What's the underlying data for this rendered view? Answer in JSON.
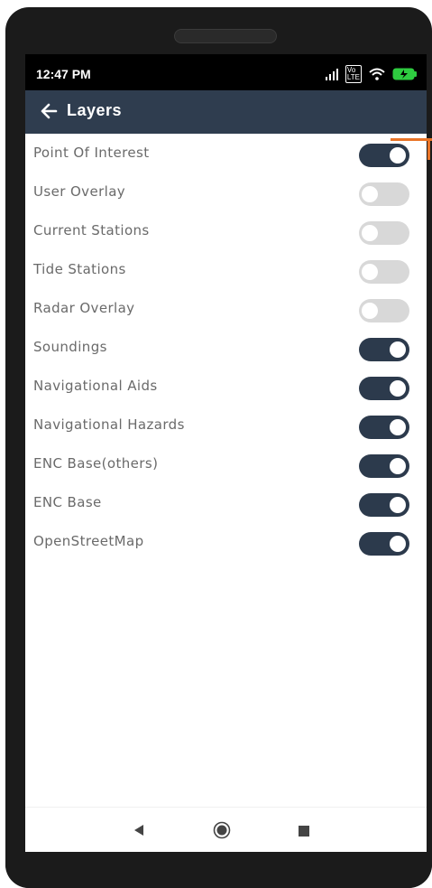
{
  "status_bar": {
    "time": "12:47 PM",
    "volte_label": "Vo) LTE"
  },
  "app_bar": {
    "title": "Layers",
    "back_icon": "arrow-left-icon"
  },
  "layers": [
    {
      "label": "Point Of Interest",
      "enabled": true
    },
    {
      "label": "User Overlay",
      "enabled": false
    },
    {
      "label": "Current Stations",
      "enabled": false
    },
    {
      "label": "Tide Stations",
      "enabled": false
    },
    {
      "label": "Radar Overlay",
      "enabled": false
    },
    {
      "label": "Soundings",
      "enabled": true
    },
    {
      "label": "Navigational Aids",
      "enabled": true
    },
    {
      "label": "Navigational Hazards",
      "enabled": true
    },
    {
      "label": "ENC Base(others)",
      "enabled": true
    },
    {
      "label": "ENC Base",
      "enabled": true
    },
    {
      "label": "OpenStreetMap",
      "enabled": true
    }
  ],
  "nav_bar": {
    "back": "triangle-back-icon",
    "home": "circle-home-icon",
    "recents": "square-recents-icon"
  },
  "colors": {
    "app_bar": "#2f3d4f",
    "toggle_on": "#2c3a4c",
    "toggle_off": "#d8d8d8",
    "callout": "#e97427"
  }
}
